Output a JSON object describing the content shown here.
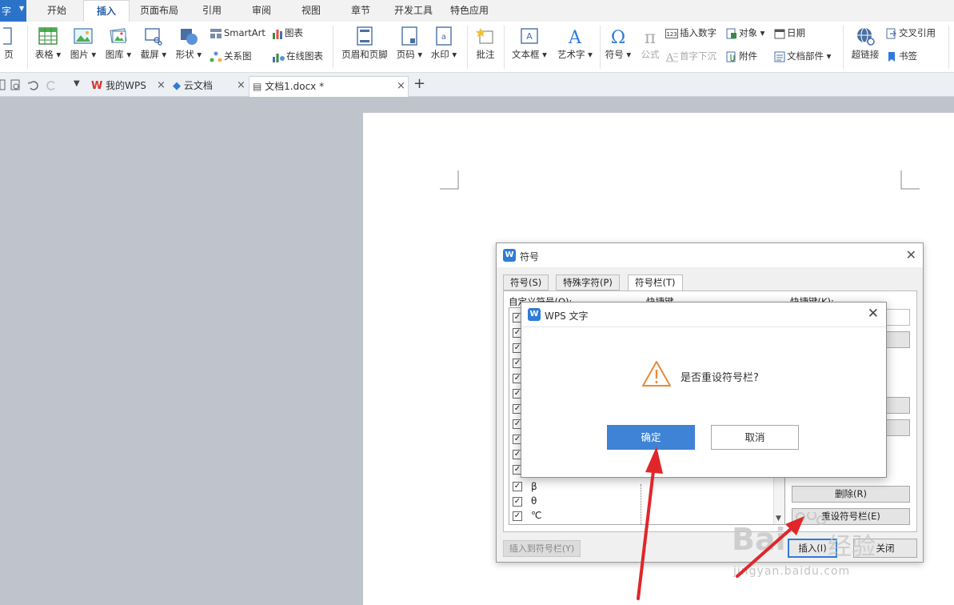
{
  "app": {
    "corner_label": "字"
  },
  "menu": {
    "tabs": [
      "开始",
      "插入",
      "页面布局",
      "引用",
      "审阅",
      "视图",
      "章节",
      "开发工具",
      "特色应用"
    ],
    "active": "插入"
  },
  "ribbon": {
    "page_partial": "页",
    "table": "表格",
    "picture": "图片",
    "gallery": "图库",
    "screenshot": "截屏",
    "shape": "形状",
    "smartart": "SmartArt",
    "chart": "图表",
    "relation": "关系图",
    "online_chart": "在线图表",
    "header_footer": "页眉和页脚",
    "page_number": "页码",
    "watermark": "水印",
    "comment": "批注",
    "textbox": "文本框",
    "wordart": "艺术字",
    "symbol": "符号",
    "formula": "公式",
    "insert_number": "插入数字",
    "drop_cap": "首字下沉",
    "object": "对象",
    "attachment": "附件",
    "date": "日期",
    "doc_parts": "文档部件",
    "hyperlink": "超链接",
    "cross_ref": "交叉引用",
    "bookmark": "书签"
  },
  "doc_tabs": [
    {
      "label": "我的WPS"
    },
    {
      "label": "云文档"
    },
    {
      "label": "文档1.docx *"
    }
  ],
  "symbol_dialog": {
    "title": "符号",
    "tabs": [
      "符号(S)",
      "特殊字符(P)",
      "符号栏(T)"
    ],
    "active_tab": "符号栏(T)",
    "custom_symbols_label": "自定义符号(O):",
    "shortcut_col_label": "快捷键",
    "shortcut_label": "快捷键(K):",
    "visible_symbols": [
      "β",
      "θ",
      "℃"
    ],
    "delete_button": "删除(R)",
    "reset_button": "重设符号栏(E)",
    "insert_to_bar": "插入到符号栏(Y)",
    "insert_button": "插入(I)",
    "close_button": "关闭"
  },
  "confirm_dialog": {
    "title": "WPS 文字",
    "message": "是否重设符号栏?",
    "ok": "确定",
    "cancel": "取消"
  },
  "watermark": {
    "text1": "Bai",
    "text2": "经验",
    "url": "jingyan.baidu.com"
  },
  "colors": {
    "accent": "#3f83d6",
    "arrow": "#e0262a",
    "menu_bg": "#f2f2f2",
    "workspace": "#bfc3cb"
  }
}
